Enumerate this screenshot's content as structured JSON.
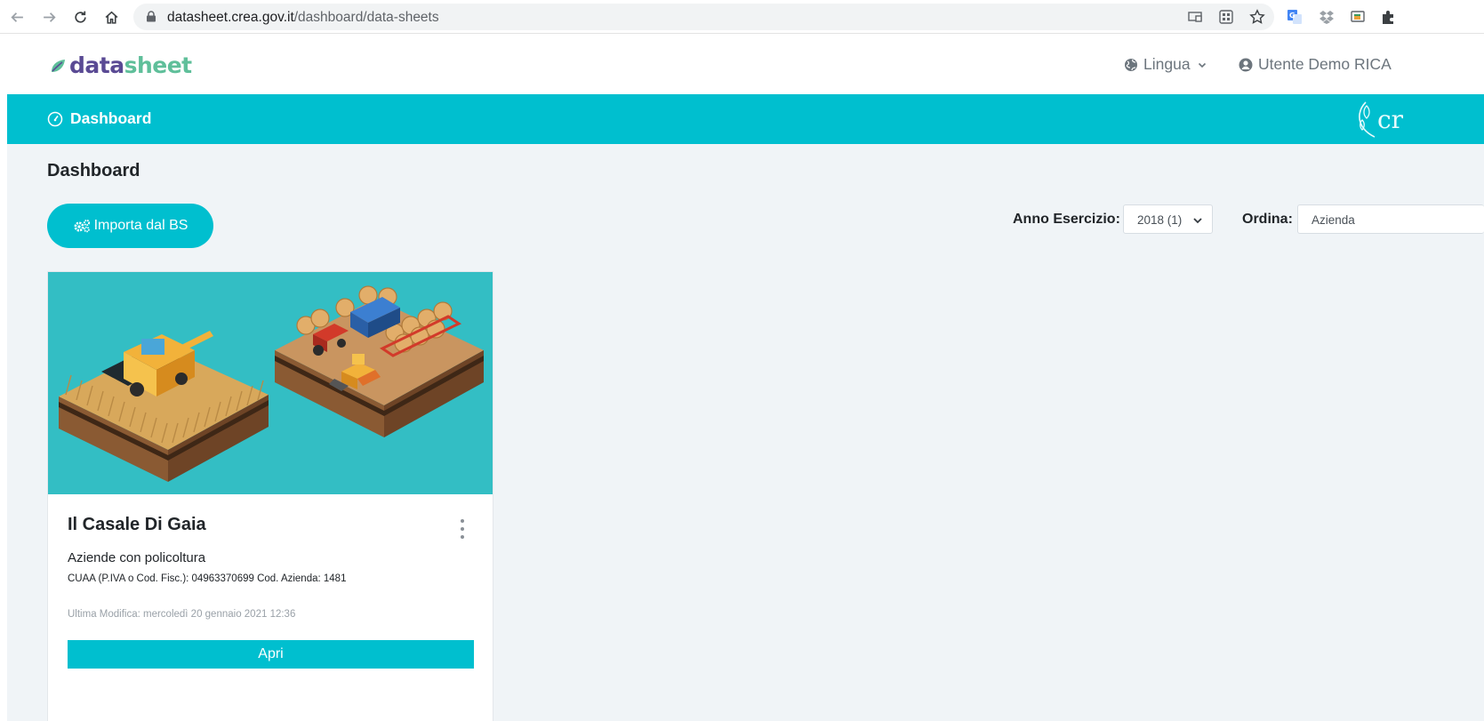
{
  "browser": {
    "url_host": "datasheet.crea.gov.it",
    "url_path": "/dashboard/data-sheets",
    "nav_icons": [
      "back-arrow-icon",
      "forward-arrow-icon",
      "reload-icon",
      "home-icon"
    ],
    "extension_icons": [
      "cast-icon",
      "qr-code-icon",
      "star-bookmark-icon",
      "google-translate-icon",
      "dropbox-icon",
      "screenshot-icon",
      "puzzle-extensions-icon"
    ]
  },
  "header": {
    "logo_part1": "data",
    "logo_part2": "sheet",
    "language_label": "Lingua",
    "user_label": "Utente Demo RICA"
  },
  "navbar": {
    "dashboard_label": "Dashboard",
    "brand_text": "cr"
  },
  "main": {
    "title": "Dashboard",
    "import_button": "Importa dal BS",
    "filters": {
      "year_label": "Anno Esercizio:",
      "year_value": "2018 (1)",
      "order_label": "Ordina:",
      "order_value": "Azienda"
    },
    "card": {
      "title": "Il Casale Di Gaia",
      "type": "Aziende con policoltura",
      "codes": "CUAA (P.IVA o Cod. Fisc.): 04963370699 Cod. Azienda: 1481",
      "modified": "Ultima Modifica: mercoledì 20 gennaio 2021 12:36",
      "open_button": "Apri"
    }
  },
  "colors": {
    "accent": "#00bfcf",
    "card_image_bg": "#33bec4",
    "page_bg": "#f0f4f7"
  }
}
